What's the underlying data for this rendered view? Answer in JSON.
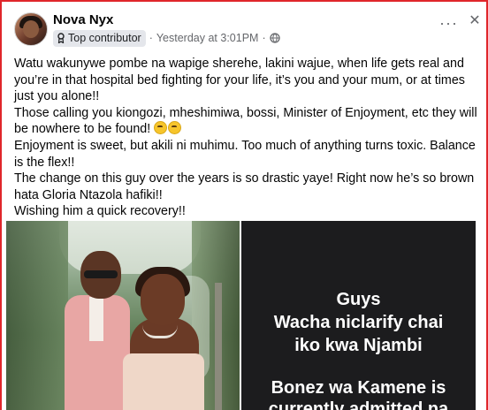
{
  "post": {
    "author": "Nova Nyx",
    "badge": "Top contributor",
    "timestamp": "Yesterday at 3:01PM",
    "dot": "·",
    "more_label": "···",
    "close_label": "✕",
    "lines": [
      "Watu wakunywe pombe na wapige sherehe, lakini wajue, when life gets real and you’re in that hospital bed fighting for your life, it’s you and your mum, or at times just you alone!!",
      "Those calling you kiongozi, mheshimiwa, bossi, Minister of Enjoyment, etc they will be nowhere to be found!",
      "Enjoyment is sweet, but akili ni muhimu. Too much of anything turns toxic. Balance is the flex!!",
      "The change on this guy over the years is so drastic yaye! Right now he’s so brown hata Gloria Ntazola hafiki!!",
      "Wishing him a quick recovery!!"
    ],
    "emojis": [
      "flushed-face",
      "flushed-face"
    ]
  },
  "image_right": {
    "lines": [
      "Guys",
      "Wacha niclarify chai",
      "iko kwa Njambi",
      "Bonez wa Kamene is",
      "currently admitted na"
    ]
  },
  "icons": {
    "badge": "ribbon-icon",
    "privacy": "globe-icon",
    "more": "more-options-icon",
    "close": "close-icon"
  },
  "colors": {
    "frame": "#e0262b",
    "text": "#050505",
    "muted": "#65676b",
    "badge_bg": "#e4e6eb",
    "dark_panel": "#1c1c1e"
  }
}
